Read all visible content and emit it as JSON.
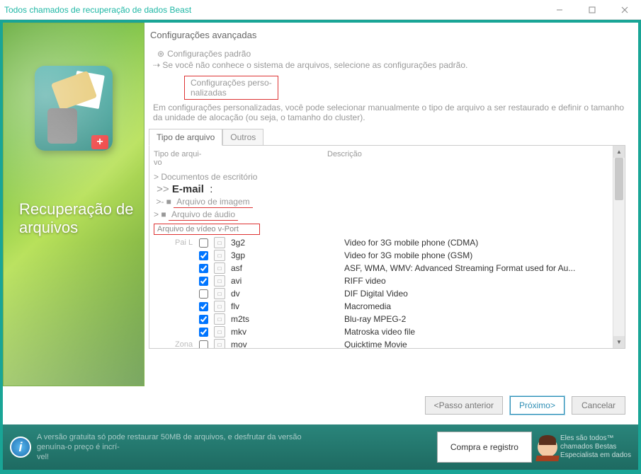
{
  "window": {
    "title": "Todos chamados de recuperação de dados Beast"
  },
  "sidebar": {
    "title": "Recuperação de arquivos"
  },
  "main": {
    "heading": "Configurações avançadas",
    "radio_default": "Configurações padrão",
    "hint_default": "Se você não conhece o sistema de arquivos, selecione as configurações padrão.",
    "radio_custom": "Configurações perso-\nnalizadas",
    "hint_custom": "Em configurações personalizadas, você pode selecionar manualmente o tipo de arquivo a ser restaurado e definir o tamanho da unidade de alocação (ou seja, o tamanho do cluster)."
  },
  "tabs": {
    "active": "Tipo de arquivo",
    "other": "Outros"
  },
  "columns": {
    "type": "Tipo de arqui-\nvo",
    "desc": "Descrição"
  },
  "categories": {
    "docs": "Documentos de escritório",
    "email": "E-mail",
    "image": "Arquivo de imagem",
    "audio": "Arquivo de áudio",
    "video_box": "Arquivo de vídeo v-Port"
  },
  "rows": [
    {
      "lead": "Pai L",
      "checked": false,
      "ext": "3g2",
      "desc": "Video for 3G mobile phone (CDMA)"
    },
    {
      "lead": "",
      "checked": true,
      "ext": "3gp",
      "desc": "Video for 3G mobile phone (GSM)"
    },
    {
      "lead": "",
      "checked": true,
      "ext": "asf",
      "desc": "ASF, WMA, WMV: Advanced Streaming Format used for Au..."
    },
    {
      "lead": "",
      "checked": true,
      "ext": "avi",
      "desc": "RIFF video"
    },
    {
      "lead": "",
      "checked": false,
      "ext": "dv",
      "desc": "DIF Digital Video"
    },
    {
      "lead": "",
      "checked": true,
      "ext": "flv",
      "desc": "Macromedia"
    },
    {
      "lead": "",
      "checked": true,
      "ext": "m2ts",
      "desc": "Blu-ray MPEG-2"
    },
    {
      "lead": "",
      "checked": true,
      "ext": "mkv",
      "desc": "Matroska video file"
    },
    {
      "lead": "Zona",
      "checked": false,
      "ext": "mov",
      "desc": "Quicktime Movie"
    }
  ],
  "buttons": {
    "prev": "<Passo anterior",
    "next": "Próximo>",
    "cancel": "Cancelar"
  },
  "footer": {
    "text": "A versão gratuita só pode restaurar 50MB de arquivos, e desfrutar da versão genuína-o preço é incrí-\nvel!",
    "buy": "Compra e registro",
    "mascot_l1": "Eles são todos™",
    "mascot_l2": "chamados Bestas",
    "mascot_l3": "Especialista em dados"
  }
}
